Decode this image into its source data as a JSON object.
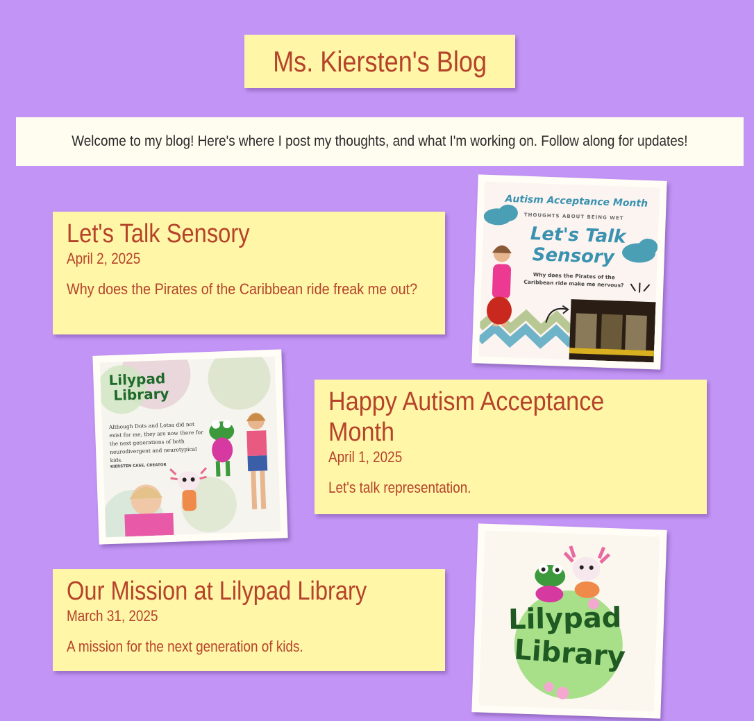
{
  "header": {
    "title": "Ms. Kiersten's Blog"
  },
  "intro": {
    "text": "Welcome to my blog! Here's where I post my thoughts, and what I'm working on. Follow along for updates!"
  },
  "posts": [
    {
      "title": "Let's Talk Sensory",
      "date": "April 2, 2025",
      "summary": "Why does the Pirates of the Caribbean ride freak me out?",
      "image": {
        "heading": "Autism Acceptance Month",
        "subheading": "THOUGHTS ABOUT BEING WET",
        "title_line1": "Let's Talk",
        "title_line2": "Sensory",
        "caption": "Why does the Pirates of the Caribbean ride make me nervous?"
      }
    },
    {
      "title": "Happy Autism Acceptance Month",
      "date": "April 1, 2025",
      "summary": "Let's talk representation.",
      "image": {
        "logo_line1": "Lilypad",
        "logo_line2": "Library",
        "body": "Although Dots and Lotsa did not exist for me, they are now there for the next generations of both neurodivergent and neurotypical kids.",
        "credit": "KIERSTEN CASE, CREATOR"
      }
    },
    {
      "title": "Our Mission at Lilypad Library",
      "date": "March 31, 2025",
      "summary": "A mission for the next generation of kids.",
      "image": {
        "logo_line1": "Lilypad",
        "logo_line2": "Library"
      }
    }
  ],
  "colors": {
    "background": "#c294f5",
    "card": "#fff6a8",
    "text_accent": "#b5432a",
    "intro_bg": "#fffdf0"
  }
}
